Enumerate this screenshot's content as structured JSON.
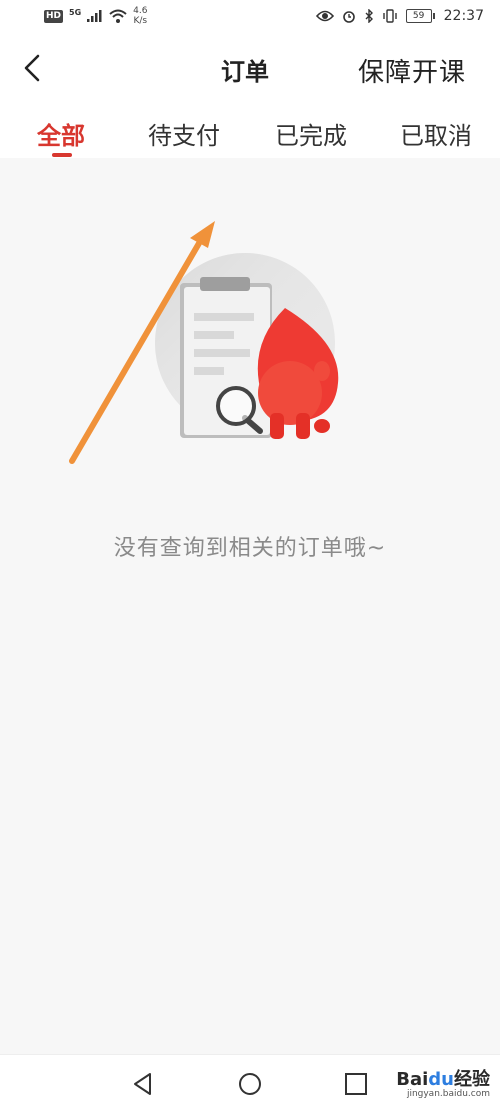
{
  "status_bar": {
    "hd": "HD",
    "network": "5G",
    "speed_value": "4.6",
    "speed_unit": "K/s",
    "battery": "59",
    "time": "22:37"
  },
  "header": {
    "title": "订单",
    "right_action": "保障开课"
  },
  "tabs": [
    {
      "label": "全部",
      "active": true
    },
    {
      "label": "待支付",
      "active": false
    },
    {
      "label": "已完成",
      "active": false
    },
    {
      "label": "已取消",
      "active": false
    }
  ],
  "empty_state": {
    "message": "没有查询到相关的订单哦~"
  },
  "watermark": {
    "logo_text_1": "Bai",
    "logo_text_2": "du",
    "logo_text_3": "经验",
    "sub": "jingyan.baidu.com"
  },
  "colors": {
    "accent": "#d8372f",
    "arrow": "#f0923a"
  }
}
